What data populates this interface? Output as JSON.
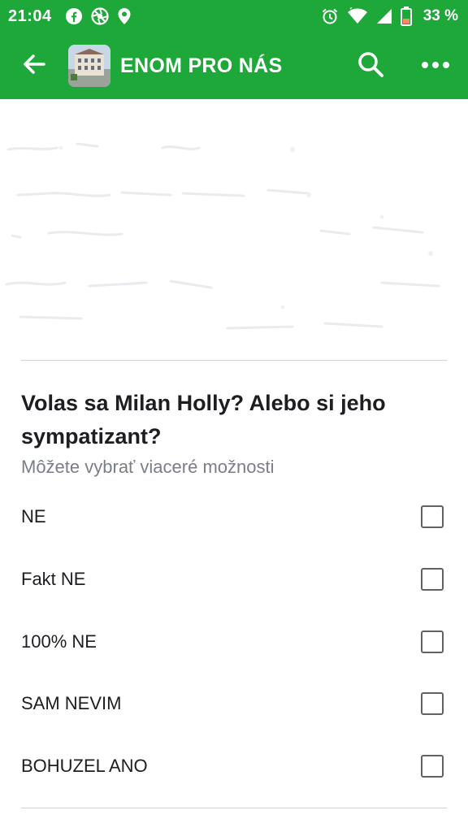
{
  "status_bar": {
    "time": "21:04",
    "battery_percent": "33 %",
    "left_icons": [
      "facebook-icon",
      "aperture-icon",
      "location-pin-icon"
    ],
    "right_icons": [
      "alarm-icon",
      "wifi-icon",
      "cell-signal-icon",
      "battery-icon"
    ]
  },
  "app_bar": {
    "title": "ENOM PRO NÁS",
    "back_icon": "arrow-back-icon",
    "search_icon": "search-icon",
    "more_icon": "more-horizontal-icon",
    "background_color": "#1fa83a"
  },
  "poll": {
    "question": "Volas sa Milan Holly? Alebo si jeho sympatizant?",
    "hint": "Môžete vybrať viaceré možnosti",
    "options": [
      {
        "label": "NE",
        "checked": false
      },
      {
        "label": "Fakt NE",
        "checked": false
      },
      {
        "label": "100% NE",
        "checked": false
      },
      {
        "label": "SAM NEVIM",
        "checked": false
      },
      {
        "label": "BOHUZEL ANO",
        "checked": false
      }
    ]
  }
}
